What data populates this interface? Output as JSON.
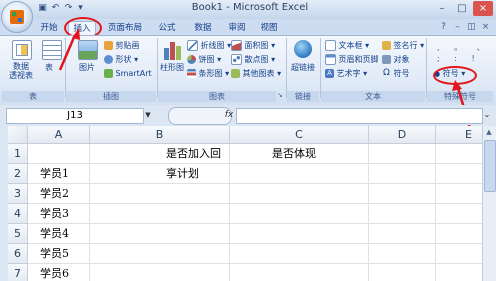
{
  "window": {
    "title": "Book1 - Microsoft Excel",
    "controls": [
      "–",
      "□",
      "×"
    ],
    "qat": [
      "save-icon",
      "undo-icon",
      "redo-icon",
      "dropdown-icon"
    ]
  },
  "tabs": [
    {
      "label": "开始",
      "active": false
    },
    {
      "label": "插入",
      "active": true
    },
    {
      "label": "页面布局",
      "active": false
    },
    {
      "label": "公式",
      "active": false
    },
    {
      "label": "数据",
      "active": false
    },
    {
      "label": "审阅",
      "active": false
    },
    {
      "label": "视图",
      "active": false
    }
  ],
  "ribbon": {
    "tables_group": {
      "label": "表",
      "pivot": "数据\n透视表",
      "table": "表"
    },
    "illustrations_group": {
      "label": "插图",
      "picture": "图片",
      "clipart": "剪贴画",
      "shapes": "形状",
      "smartart": "SmartArt"
    },
    "charts_group": {
      "label": "图表",
      "column": "柱形图",
      "line": "折线图",
      "pie": "饼图",
      "bar": "条形图",
      "area": "面积图",
      "scatter": "散点图",
      "other": "其他图表"
    },
    "links_group": {
      "label": "链接",
      "hyperlink": "超链接"
    },
    "text_group": {
      "label": "文本",
      "textbox": "文本框",
      "header_footer": "页眉和页脚",
      "wordart": "艺术字",
      "signature": "签名行",
      "object": "对象",
      "symbol": "符号"
    },
    "special_group": {
      "label": "特殊符号",
      "symbol": "符号"
    }
  },
  "formula_bar": {
    "name_box": "J13",
    "fx": "fx",
    "value": ""
  },
  "sheet": {
    "columns": [
      "A",
      "B",
      "C",
      "D",
      "E"
    ],
    "rows": [
      {
        "num": "1",
        "cells": [
          "",
          "是否加入回享计划",
          "是否体现",
          "",
          ""
        ]
      },
      {
        "num": "2",
        "cells": [
          "学员1",
          "",
          "",
          "",
          ""
        ]
      },
      {
        "num": "3",
        "cells": [
          "学员2",
          "",
          "",
          "",
          ""
        ]
      },
      {
        "num": "4",
        "cells": [
          "学员3",
          "",
          "",
          "",
          ""
        ]
      },
      {
        "num": "5",
        "cells": [
          "学员4",
          "",
          "",
          "",
          ""
        ]
      },
      {
        "num": "6",
        "cells": [
          "学员5",
          "",
          "",
          "",
          ""
        ]
      },
      {
        "num": "7",
        "cells": [
          "学员6",
          "",
          "",
          "",
          ""
        ]
      }
    ]
  },
  "annotations": {
    "color": "#e3161c"
  }
}
